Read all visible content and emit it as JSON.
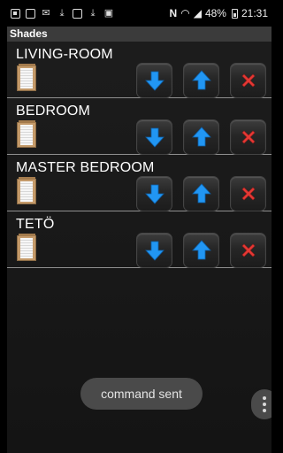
{
  "status_bar": {
    "battery_percent": "48%",
    "time": "21:31",
    "left_icons": [
      "flipboard-icon",
      "image-icon",
      "mail-icon",
      "download-icon",
      "image-icon",
      "download-icon",
      "briefcase-icon"
    ],
    "right_icons": [
      "nfc-icon",
      "wifi-icon",
      "signal-icon",
      "battery-icon"
    ]
  },
  "app": {
    "title": "Shades"
  },
  "rooms": [
    {
      "name": "LIVING-ROOM"
    },
    {
      "name": "BEDROOM"
    },
    {
      "name": "MASTER BEDROOM"
    },
    {
      "name": "TETÖ"
    }
  ],
  "controls": {
    "down_icon": "arrow-down-icon",
    "up_icon": "arrow-up-icon",
    "stop_icon": "cross-icon",
    "colors": {
      "arrow": "#2196f3",
      "cross": "#e53935"
    }
  },
  "toast": {
    "message": "command sent"
  },
  "overflow_menu": {
    "icon": "more-vertical-icon"
  }
}
